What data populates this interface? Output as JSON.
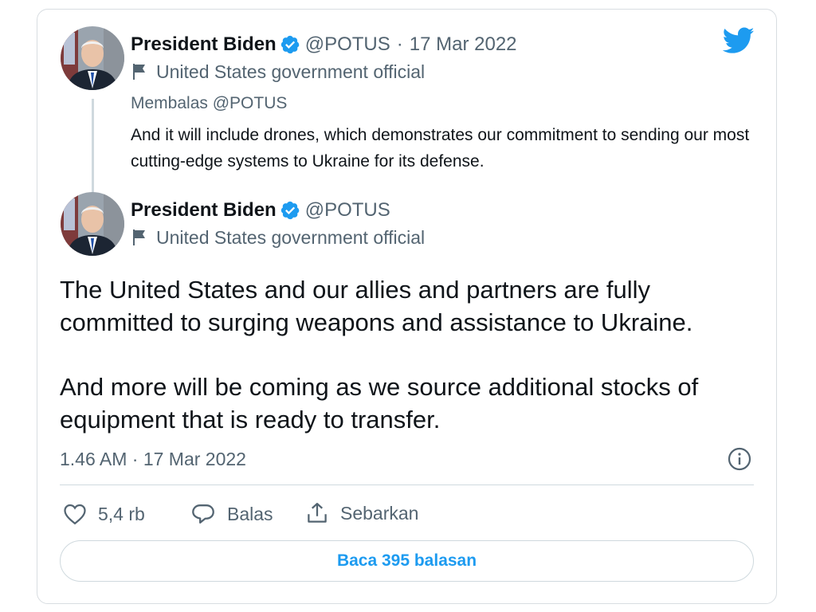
{
  "reply_tweet": {
    "author_name": "President Biden",
    "handle": "@POTUS",
    "separator": "·",
    "date": "17 Mar 2022",
    "label": "United States government official",
    "replying_to": "Membalas @POTUS",
    "text": "And it will include drones, which demonstrates our commitment to sending our most cutting-edge systems to Ukraine for its defense."
  },
  "main_tweet": {
    "author_name": "President Biden",
    "handle": "@POTUS",
    "label": "United States government official",
    "paragraph_1": "The United States and our allies and partners are fully committed to surging weapons and assistance to Ukraine.",
    "paragraph_2": "And more will be coming as we source additional stocks of equipment that is ready to transfer.",
    "timestamp": "1.46 AM · 17 Mar 2022"
  },
  "actions": {
    "like_count": "5,4 rb",
    "reply_label": "Balas",
    "share_label": "Sebarkan"
  },
  "read_replies_label": "Baca 395 balasan",
  "colors": {
    "twitter_blue": "#1d9bf0",
    "text_primary": "#0f1419",
    "text_secondary": "#536471",
    "border": "#cfd9de"
  },
  "icons": {
    "brand": "twitter-bird-icon",
    "verified": "verified-badge-icon",
    "label": "flag-icon",
    "info": "info-icon",
    "like": "heart-icon",
    "reply": "speech-bubble-icon",
    "share": "share-upload-icon"
  }
}
